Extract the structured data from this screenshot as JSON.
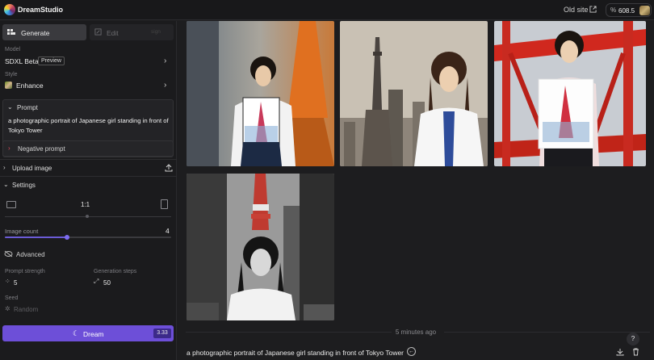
{
  "topbar": {
    "brand": "DreamStudio",
    "old_site": "Old site",
    "credits": "608.5",
    "credit_icon": "%"
  },
  "sidebar": {
    "tabs": [
      {
        "label": "Generate",
        "icon": "generate-icon"
      },
      {
        "label": "Edit",
        "icon": "edit-icon",
        "badge": "sign"
      }
    ],
    "model": {
      "label": "Model",
      "value": "SDXL Beta",
      "badge": "Preview"
    },
    "style": {
      "label": "Style",
      "value": "Enhance"
    },
    "prompt": {
      "header": "Prompt",
      "text": "a photographic portrait of Japanese girl standing in front of Tokyo Tower"
    },
    "negative_prompt": {
      "header": "Negative prompt"
    },
    "upload_image": {
      "header": "Upload image"
    },
    "settings": {
      "header": "Settings",
      "aspect_ratio": "1:1",
      "image_count_label": "Image count",
      "image_count_value": "4",
      "image_count_fraction": 0.375,
      "advanced": "Advanced",
      "prompt_strength_label": "Prompt strength",
      "prompt_strength_value": "5",
      "generation_steps_label": "Generation steps",
      "generation_steps_value": "50",
      "seed_label": "Seed",
      "seed_value": "Random"
    },
    "dream_button": {
      "label": "Dream",
      "cost": "3.33"
    }
  },
  "main": {
    "timestamp": "5 minutes ago",
    "prompt_text": "a photographic portrait of Japanese girl standing in front of Tokyo Tower",
    "help": "?",
    "images": [
      {
        "name": "result-image-1",
        "alt": "girl holding tower picture in front of orange tower"
      },
      {
        "name": "result-image-2",
        "alt": "girl next to Tokyo skyline tower"
      },
      {
        "name": "result-image-3",
        "alt": "girl holding tower print under red tower structure"
      },
      {
        "name": "result-image-4",
        "alt": "black and white portrait with tower"
      }
    ]
  },
  "colors": {
    "accent": "#6d4fd8",
    "background": "#1d1d1f",
    "sidebar": "#1b1b1d"
  }
}
